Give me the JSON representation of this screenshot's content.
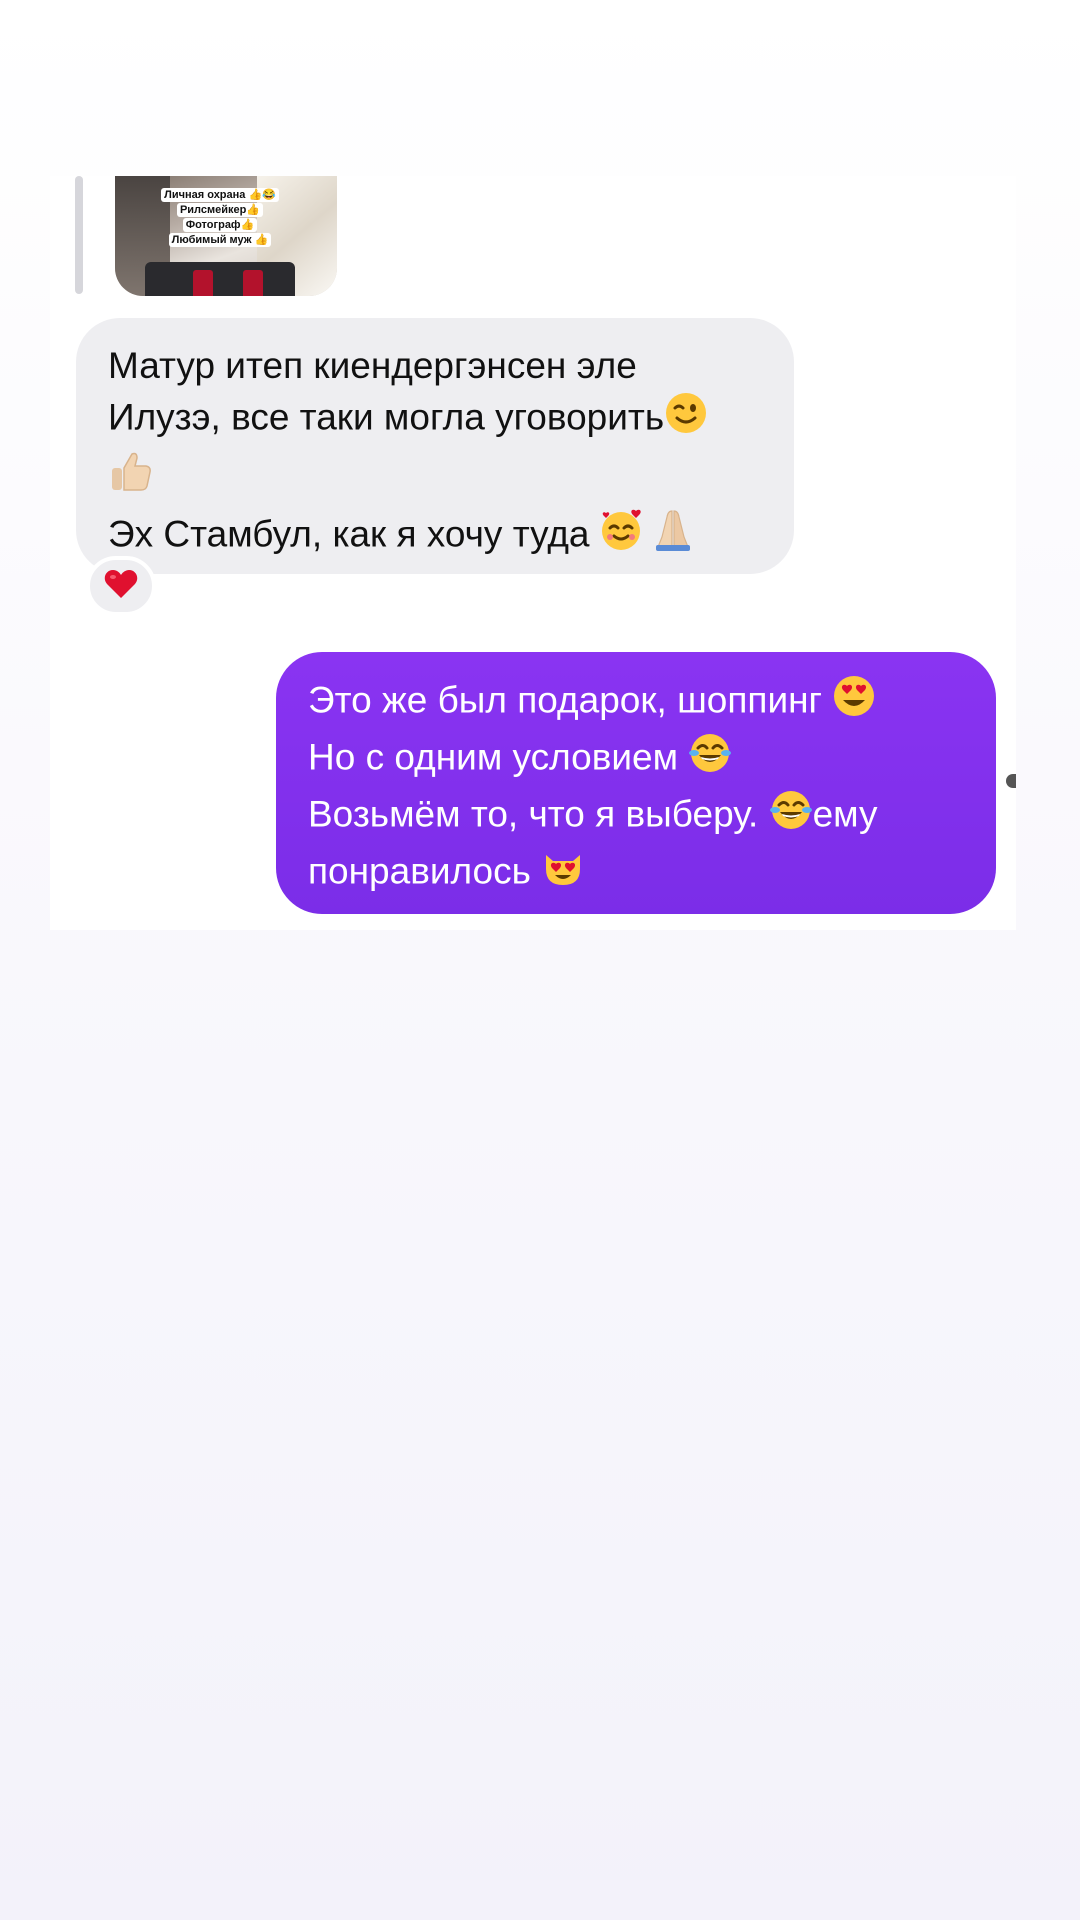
{
  "conversation": {
    "reply_image_caption": [
      "Личная охрана 👍😂",
      "Рилсмейкер👍",
      "Фотограф👍",
      "Любимый муж 👍"
    ],
    "incoming_message": {
      "lines": [
        "Матур итеп киендергэнсен эле",
        "Илузэ, все таки могла уговорить",
        "",
        "Эх Стамбул, как я хочу туда "
      ],
      "reaction": "heart"
    },
    "outgoing_message": {
      "lines": [
        "Это же был подарок, шоппинг ",
        "Но с одним условием ",
        "Возьмём то, что я выберу. ",
        "понравилось "
      ],
      "line3_suffix": "ему"
    }
  },
  "icons": {
    "wink": "winking-face-emoji",
    "thumbs_up": "thumbs-up-emoji",
    "hearts_face": "smiling-face-with-hearts-emoji",
    "pray": "folded-hands-emoji",
    "heart_eyes": "heart-eyes-emoji",
    "laugh": "tears-of-joy-emoji",
    "cat_heart_eyes": "heart-eyes-cat-emoji",
    "reaction_heart": "red-heart-emoji"
  },
  "colors": {
    "incoming_bubble": "#eeeef1",
    "outgoing_bubble": "#8a34f2",
    "reaction_heart": "#e0102f"
  }
}
